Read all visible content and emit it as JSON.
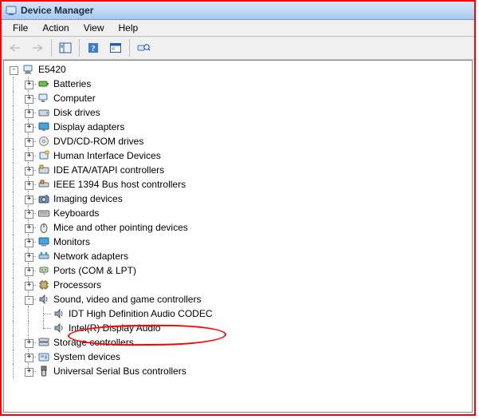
{
  "window": {
    "title": "Device Manager"
  },
  "menubar": {
    "file": "File",
    "action": "Action",
    "view": "View",
    "help": "Help"
  },
  "root": {
    "name": "E5420",
    "expanded": true
  },
  "nodes": [
    {
      "label": "Batteries",
      "icon": "battery",
      "expanded": false
    },
    {
      "label": "Computer",
      "icon": "computer",
      "expanded": false
    },
    {
      "label": "Disk drives",
      "icon": "disk",
      "expanded": false
    },
    {
      "label": "Display adapters",
      "icon": "display",
      "expanded": false
    },
    {
      "label": "DVD/CD-ROM drives",
      "icon": "dvd",
      "expanded": false
    },
    {
      "label": "Human Interface Devices",
      "icon": "hid",
      "expanded": false
    },
    {
      "label": "IDE ATA/ATAPI controllers",
      "icon": "ide",
      "expanded": false
    },
    {
      "label": "IEEE 1394 Bus host controllers",
      "icon": "ieee",
      "expanded": false
    },
    {
      "label": "Imaging devices",
      "icon": "imaging",
      "expanded": false
    },
    {
      "label": "Keyboards",
      "icon": "keyboard",
      "expanded": false
    },
    {
      "label": "Mice and other pointing devices",
      "icon": "mouse",
      "expanded": false
    },
    {
      "label": "Monitors",
      "icon": "monitor",
      "expanded": false
    },
    {
      "label": "Network adapters",
      "icon": "network",
      "expanded": false
    },
    {
      "label": "Ports (COM & LPT)",
      "icon": "ports",
      "expanded": false
    },
    {
      "label": "Processors",
      "icon": "cpu",
      "expanded": false
    },
    {
      "label": "Sound, video and game controllers",
      "icon": "sound",
      "expanded": true,
      "children": [
        {
          "label": "IDT High Definition Audio CODEC",
          "icon": "sound"
        },
        {
          "label": "Intel(R) Display Audio",
          "icon": "sound"
        }
      ]
    },
    {
      "label": "Storage controllers",
      "icon": "storage",
      "expanded": false
    },
    {
      "label": "System devices",
      "icon": "system",
      "expanded": false
    },
    {
      "label": "Universal Serial Bus controllers",
      "icon": "usb",
      "expanded": false
    }
  ]
}
